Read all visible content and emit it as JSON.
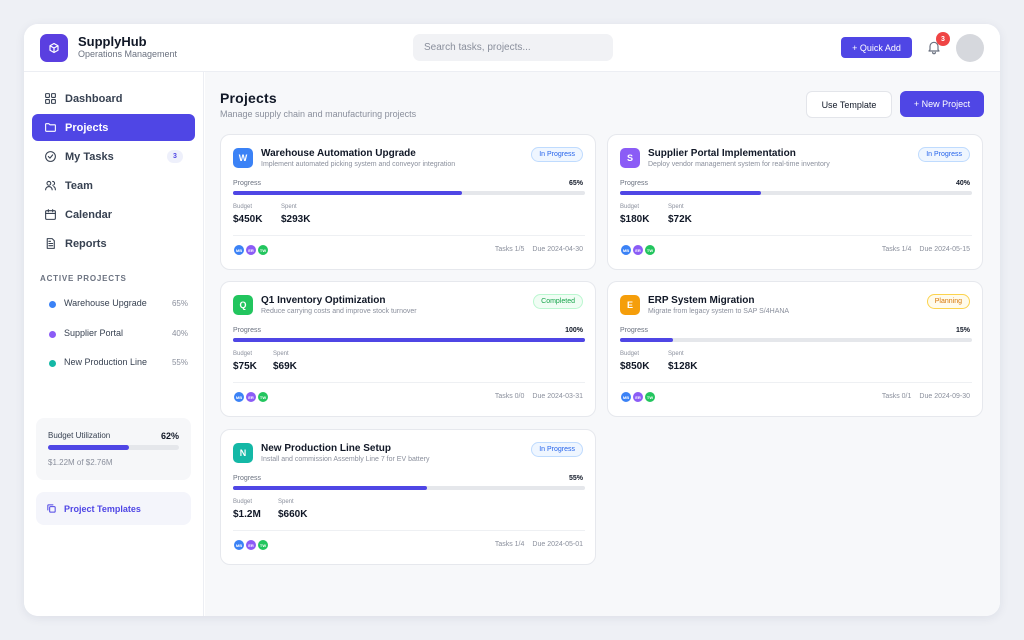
{
  "app": {
    "name": "SupplyHub",
    "subtitle": "Operations Management"
  },
  "header": {
    "search_placeholder": "Search tasks, projects...",
    "quick_add_label": "+ Quick Add",
    "notification_count": "3"
  },
  "sidebar": {
    "nav": [
      {
        "label": "Dashboard",
        "icon": "grid-icon",
        "active": false
      },
      {
        "label": "Projects",
        "icon": "folder-icon",
        "active": true
      },
      {
        "label": "My Tasks",
        "icon": "check-circle-icon",
        "active": false,
        "count": "3"
      },
      {
        "label": "Team",
        "icon": "users-icon",
        "active": false
      },
      {
        "label": "Calendar",
        "icon": "calendar-icon",
        "active": false
      },
      {
        "label": "Reports",
        "icon": "document-icon",
        "active": false
      }
    ],
    "active_projects_title": "ACTIVE PROJECTS",
    "active_projects": [
      {
        "name": "Warehouse Upgrade",
        "pct": "65%",
        "color": "#3b82f6"
      },
      {
        "name": "Supplier Portal",
        "pct": "40%",
        "color": "#8b5cf6"
      },
      {
        "name": "New Production Line",
        "pct": "55%",
        "color": "#14b8a6"
      }
    ],
    "budget": {
      "label": "Budget Utilization",
      "pct": "62%",
      "fraction": 0.62,
      "amount": "$1.22M of $2.76M"
    },
    "templates_label": "Project Templates"
  },
  "main": {
    "title": "Projects",
    "subtitle": "Manage supply chain and manufacturing projects",
    "use_template_label": "Use Template",
    "new_project_label": "+ New Project",
    "progress_label": "Progress",
    "budget_label": "Budget",
    "spent_label": "Spent",
    "projects": [
      {
        "initial": "W",
        "color": "#3b82f6",
        "name": "Warehouse Automation Upgrade",
        "desc": "Implement automated picking system and conveyor integration",
        "status": "In Progress",
        "status_type": "progress",
        "progress": "65%",
        "progress_value": 0.65,
        "budget": "$450K",
        "spent": "$293K",
        "avatars": [
          "MB",
          "ER",
          "TW"
        ],
        "tasks": "Tasks 1/5",
        "due": "Due 2024-04-30"
      },
      {
        "initial": "S",
        "color": "#8b5cf6",
        "name": "Supplier Portal Implementation",
        "desc": "Deploy vendor management system for real-time inventory",
        "status": "In Progress",
        "status_type": "progress",
        "progress": "40%",
        "progress_value": 0.4,
        "budget": "$180K",
        "spent": "$72K",
        "avatars": [
          "MB",
          "ER",
          "TW"
        ],
        "tasks": "Tasks 1/4",
        "due": "Due 2024-05-15"
      },
      {
        "initial": "Q",
        "color": "#22c55e",
        "name": "Q1 Inventory Optimization",
        "desc": "Reduce carrying costs and improve stock turnover",
        "status": "Completed",
        "status_type": "completed",
        "progress": "100%",
        "progress_value": 1.0,
        "budget": "$75K",
        "spent": "$69K",
        "avatars": [
          "MB",
          "ER",
          "TW"
        ],
        "tasks": "Tasks 0/0",
        "due": "Due 2024-03-31"
      },
      {
        "initial": "E",
        "color": "#f59e0b",
        "name": "ERP System Migration",
        "desc": "Migrate from legacy system to SAP S/4HANA",
        "status": "Planning",
        "status_type": "planning",
        "progress": "15%",
        "progress_value": 0.15,
        "budget": "$850K",
        "spent": "$128K",
        "avatars": [
          "MB",
          "ER",
          "TW"
        ],
        "tasks": "Tasks 0/1",
        "due": "Due 2024-09-30"
      },
      {
        "initial": "N",
        "color": "#14b8a6",
        "name": "New Production Line Setup",
        "desc": "Install and commission Assembly Line 7 for EV battery",
        "status": "In Progress",
        "status_type": "progress",
        "progress": "55%",
        "progress_value": 0.55,
        "budget": "$1.2M",
        "spent": "$660K",
        "avatars": [
          "MB",
          "ER",
          "TW"
        ],
        "tasks": "Tasks 1/4",
        "due": "Due 2024-05-01"
      }
    ]
  },
  "colors": {
    "accent": "#4f46e5",
    "avatar_colors": [
      "#3b82f6",
      "#8b5cf6",
      "#22c55e"
    ],
    "status": {
      "progress": {
        "bg": "#eff6ff",
        "border": "#bfdbfe",
        "text": "#2563eb"
      },
      "completed": {
        "bg": "#f0fdf4",
        "border": "#bbf7d0",
        "text": "#16a34a"
      },
      "planning": {
        "bg": "#fffbeb",
        "border": "#fcd34d",
        "text": "#d97706"
      }
    }
  }
}
